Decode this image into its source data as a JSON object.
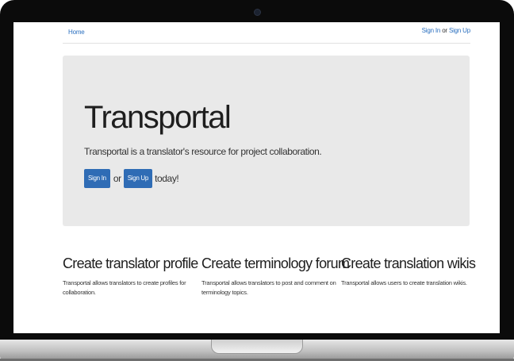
{
  "nav": {
    "home": "Home",
    "sign_in": "Sign In",
    "or": "or",
    "sign_up": "Sign Up"
  },
  "hero": {
    "title": "Transportal",
    "lead": "Transportal is a translator's resource for project collaboration.",
    "sign_in_button": "Sign In",
    "or": "or",
    "sign_up_button": "Sign Up",
    "suffix": "today!"
  },
  "features": [
    {
      "title": "Create translator profile",
      "text": "Transportal allows translators to create profiles for collaboration."
    },
    {
      "title": "Create terminology forum",
      "text": "Transportal allows translators to post and comment on terminology topics."
    },
    {
      "title": "Create translation wikis",
      "text": "Transportal allows users to create translation wikis."
    }
  ],
  "colors": {
    "link": "#2a6fbf",
    "button": "#2f6cb5",
    "jumbotron": "#e9e9e9"
  }
}
